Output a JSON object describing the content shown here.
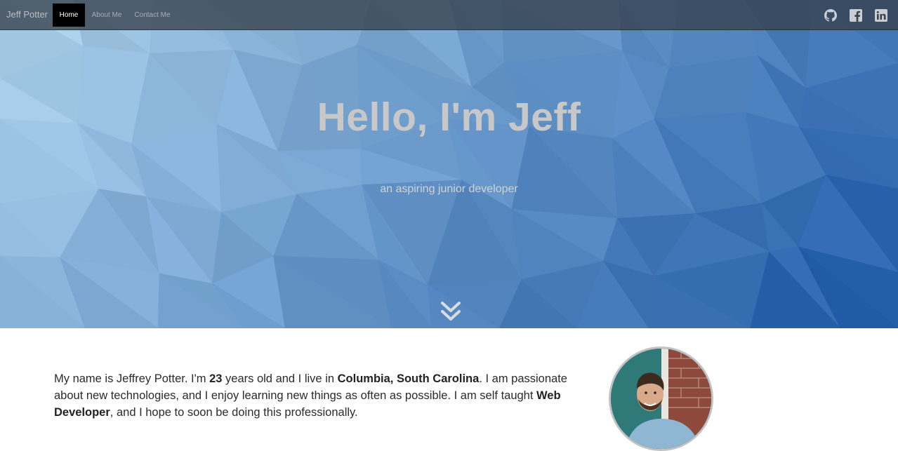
{
  "nav": {
    "brand": "Jeff Potter",
    "items": [
      {
        "label": "Home",
        "active": true
      },
      {
        "label": "About Me",
        "active": false
      },
      {
        "label": "Contact Me",
        "active": false
      }
    ],
    "social_icons": [
      "github-icon",
      "facebook-icon",
      "linkedin-icon"
    ]
  },
  "hero": {
    "title": "Hello, I'm Jeff",
    "subtitle": "an aspiring junior developer",
    "scroll_icon": "double-chevron-down-icon"
  },
  "about": {
    "segments": [
      {
        "text": "My name is Jeffrey Potter. I'm ",
        "bold": false
      },
      {
        "text": "23",
        "bold": true
      },
      {
        "text": " years old and I live in ",
        "bold": false
      },
      {
        "text": "Columbia, South Carolina",
        "bold": true
      },
      {
        "text": ". I am passionate about new technologies, and I enjoy learning new things as often as possible. I am self taught ",
        "bold": false
      },
      {
        "text": "Web Developer",
        "bold": true
      },
      {
        "text": ", and I hope to soon be doing this professionally.",
        "bold": false
      }
    ]
  },
  "colors": {
    "navbar_bg": "#37404c",
    "active_nav_bg": "#000000",
    "hero_gradient_start": "#a9cfe8",
    "hero_gradient_end": "#1f5fae",
    "hero_title": "#c8c8c8",
    "body_text": "#2b2b2b"
  }
}
